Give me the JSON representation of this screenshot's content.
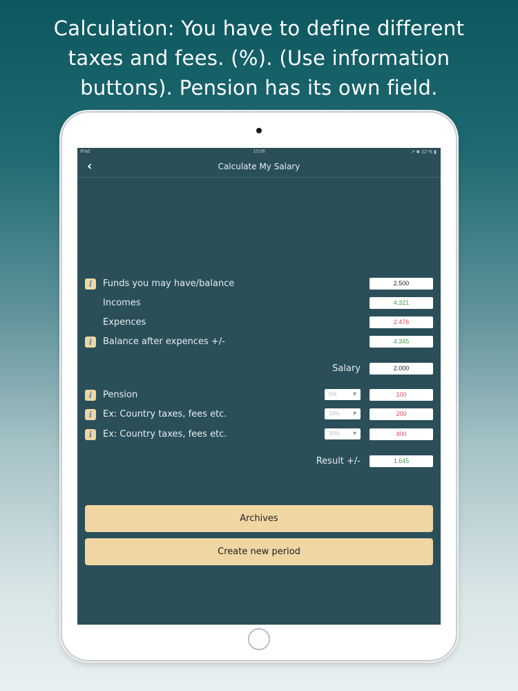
{
  "headline": {
    "line1": "Calculation: You have to define different",
    "line2": "taxes and fees. (%). (Use information",
    "line3": "buttons). Pension has its own field."
  },
  "status_bar": {
    "device": "iPad",
    "time": "13:06",
    "right": "↗ ✱ 22 % ▮"
  },
  "nav": {
    "back_glyph": "‹",
    "title": "Calculate My Salary"
  },
  "icons": {
    "info": "i"
  },
  "balance_rows": [
    {
      "label": "Funds you may have/balance",
      "value": "2.500",
      "has_info": true,
      "value_color": "#222222"
    },
    {
      "label": "Incomes",
      "value": "4.321",
      "has_info": false,
      "value_color": "#3f9a4a"
    },
    {
      "label": "Expences",
      "value": "2.476",
      "has_info": false,
      "value_color": "#e0455b"
    },
    {
      "label": "Balance after expences +/-",
      "value": "4.345",
      "has_info": true,
      "value_color": "#3f9a4a"
    }
  ],
  "salary": {
    "label": "Salary",
    "value": "2.000"
  },
  "deductions": [
    {
      "label": "Pension",
      "percent": "5%",
      "value": "100"
    },
    {
      "label": "Ex: Country taxes, fees etc.",
      "percent": "10%",
      "value": "200"
    },
    {
      "label": "Ex: Country taxes, fees etc.",
      "percent": "20%",
      "value": "400"
    }
  ],
  "result": {
    "label": "Result +/-",
    "value": "1.645"
  },
  "buttons": {
    "archives": "Archives",
    "create_period": "Create new period"
  },
  "colors": {
    "screen_bg": "#2a4f59",
    "accent": "#f0d6a3",
    "positive": "#3f9a4a",
    "negative": "#e0455b"
  }
}
